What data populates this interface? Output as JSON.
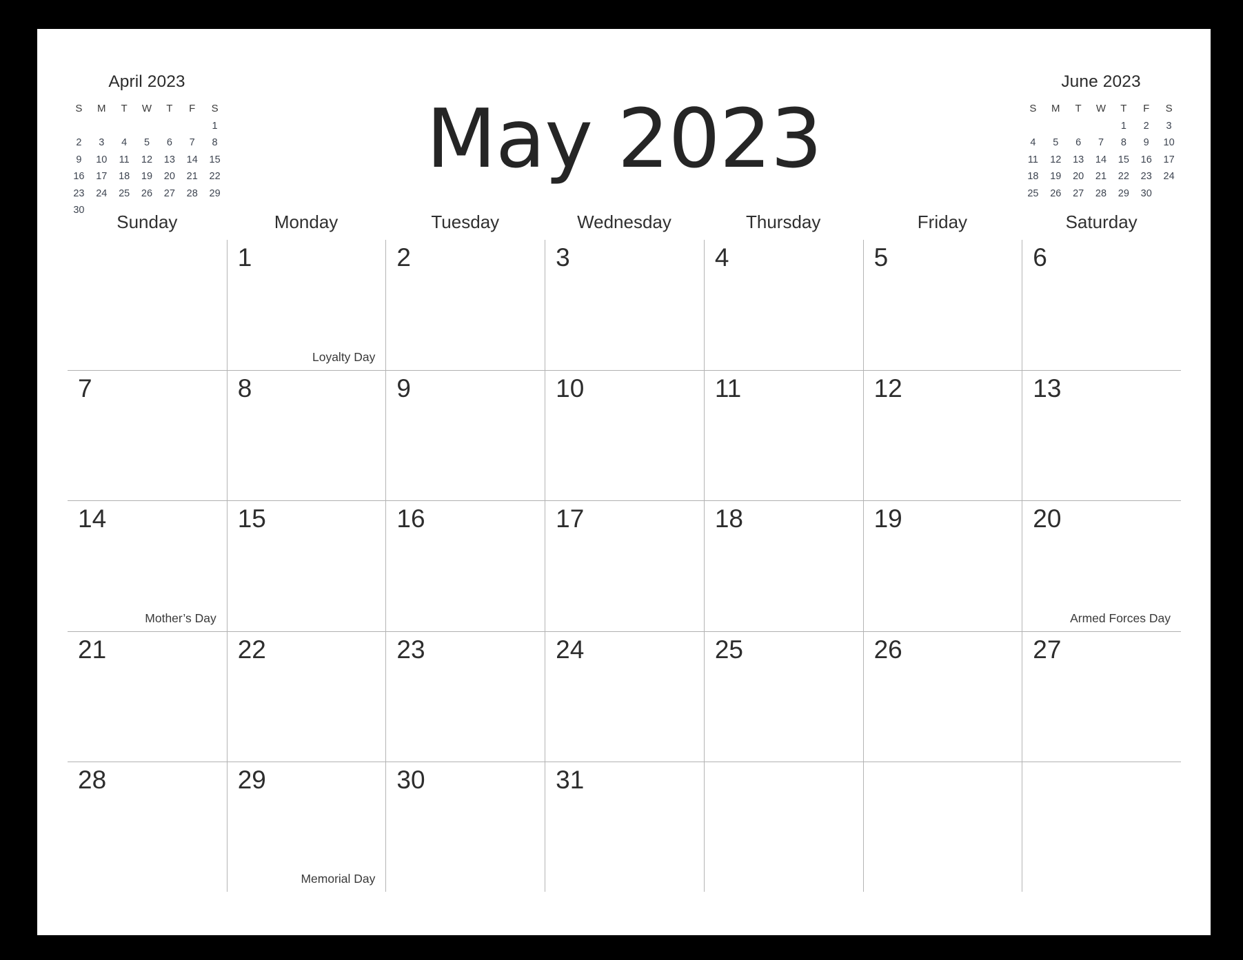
{
  "title": "May 2023",
  "colors": {
    "frame": "#000000",
    "page": "#ffffff",
    "gridline": "#b4b4b4",
    "text": "#2d2d2d",
    "event_text": "#3a3a3a"
  },
  "mini_prev": {
    "title": "April 2023",
    "dow": [
      "S",
      "M",
      "T",
      "W",
      "T",
      "F",
      "S"
    ],
    "weeks": [
      [
        "",
        "",
        "",
        "",
        "",
        "",
        "1"
      ],
      [
        "2",
        "3",
        "4",
        "5",
        "6",
        "7",
        "8"
      ],
      [
        "9",
        "10",
        "11",
        "12",
        "13",
        "14",
        "15"
      ],
      [
        "16",
        "17",
        "18",
        "19",
        "20",
        "21",
        "22"
      ],
      [
        "23",
        "24",
        "25",
        "26",
        "27",
        "28",
        "29"
      ],
      [
        "30",
        "",
        "",
        "",
        "",
        "",
        ""
      ]
    ]
  },
  "mini_next": {
    "title": "June 2023",
    "dow": [
      "S",
      "M",
      "T",
      "W",
      "T",
      "F",
      "S"
    ],
    "weeks": [
      [
        "",
        "",
        "",
        "",
        "1",
        "2",
        "3"
      ],
      [
        "4",
        "5",
        "6",
        "7",
        "8",
        "9",
        "10"
      ],
      [
        "11",
        "12",
        "13",
        "14",
        "15",
        "16",
        "17"
      ],
      [
        "18",
        "19",
        "20",
        "21",
        "22",
        "23",
        "24"
      ],
      [
        "25",
        "26",
        "27",
        "28",
        "29",
        "30",
        ""
      ]
    ]
  },
  "weekday_headers": [
    "Sunday",
    "Monday",
    "Tuesday",
    "Wednesday",
    "Thursday",
    "Friday",
    "Saturday"
  ],
  "weeks": [
    [
      {
        "day": "",
        "event": ""
      },
      {
        "day": "1",
        "event": "Loyalty Day"
      },
      {
        "day": "2",
        "event": ""
      },
      {
        "day": "3",
        "event": ""
      },
      {
        "day": "4",
        "event": ""
      },
      {
        "day": "5",
        "event": ""
      },
      {
        "day": "6",
        "event": ""
      }
    ],
    [
      {
        "day": "7",
        "event": ""
      },
      {
        "day": "8",
        "event": ""
      },
      {
        "day": "9",
        "event": ""
      },
      {
        "day": "10",
        "event": ""
      },
      {
        "day": "11",
        "event": ""
      },
      {
        "day": "12",
        "event": ""
      },
      {
        "day": "13",
        "event": ""
      }
    ],
    [
      {
        "day": "14",
        "event": "Mother’s Day"
      },
      {
        "day": "15",
        "event": ""
      },
      {
        "day": "16",
        "event": ""
      },
      {
        "day": "17",
        "event": ""
      },
      {
        "day": "18",
        "event": ""
      },
      {
        "day": "19",
        "event": ""
      },
      {
        "day": "20",
        "event": "Armed Forces Day"
      }
    ],
    [
      {
        "day": "21",
        "event": ""
      },
      {
        "day": "22",
        "event": ""
      },
      {
        "day": "23",
        "event": ""
      },
      {
        "day": "24",
        "event": ""
      },
      {
        "day": "25",
        "event": ""
      },
      {
        "day": "26",
        "event": ""
      },
      {
        "day": "27",
        "event": ""
      }
    ],
    [
      {
        "day": "28",
        "event": ""
      },
      {
        "day": "29",
        "event": "Memorial Day"
      },
      {
        "day": "30",
        "event": ""
      },
      {
        "day": "31",
        "event": ""
      },
      {
        "day": "",
        "event": ""
      },
      {
        "day": "",
        "event": ""
      },
      {
        "day": "",
        "event": ""
      }
    ]
  ]
}
